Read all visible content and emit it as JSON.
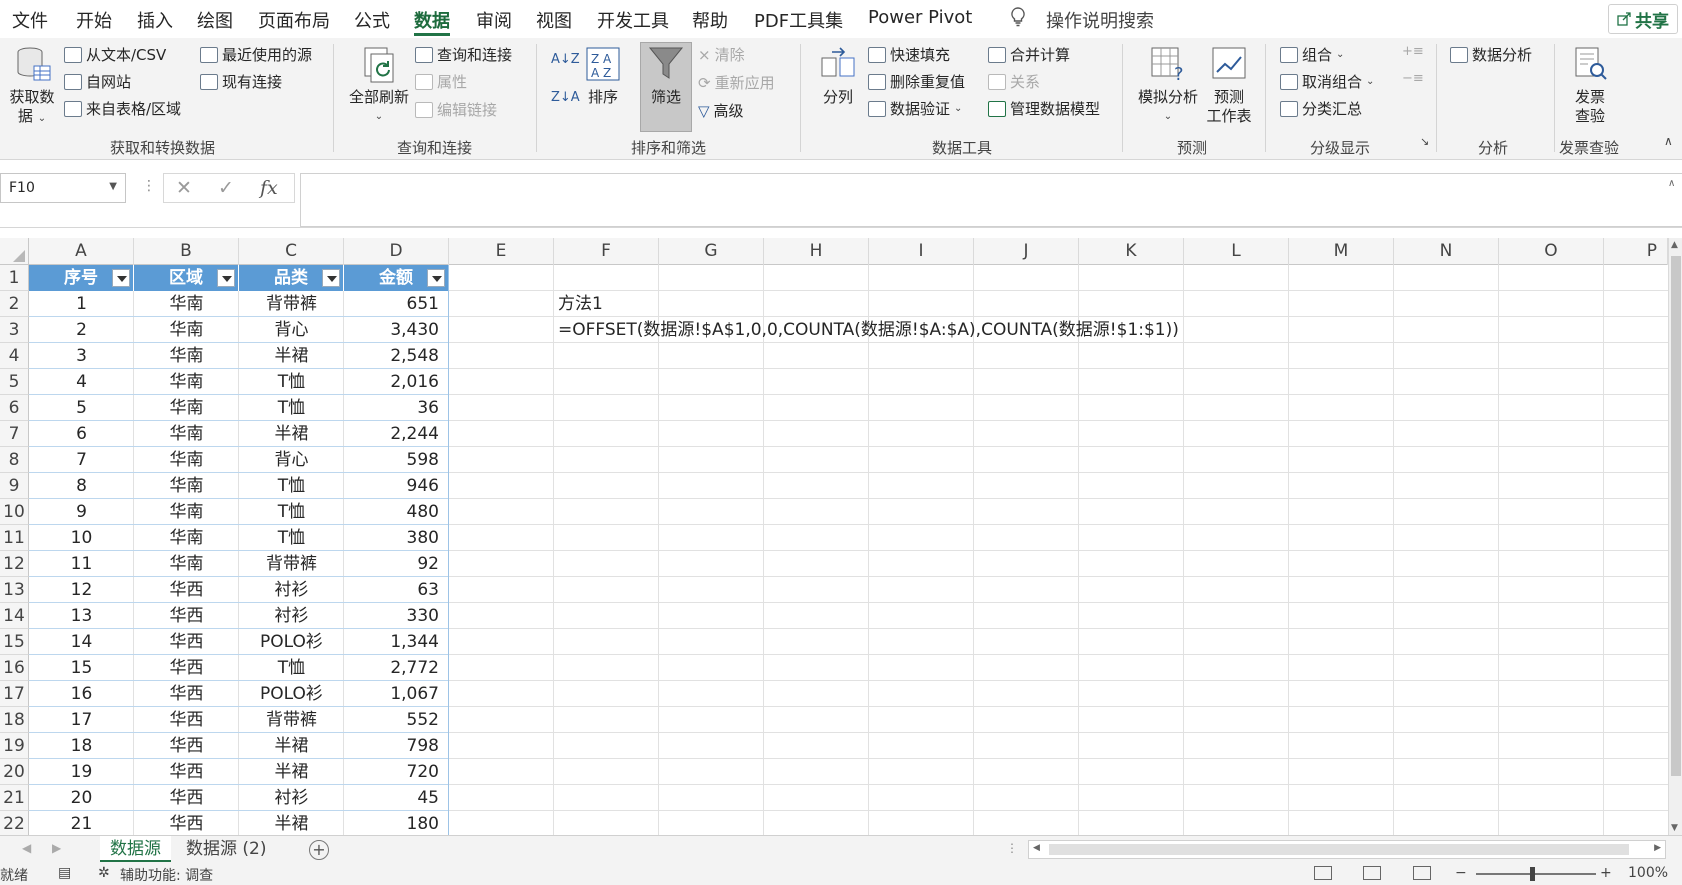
{
  "menu": {
    "items": [
      "文件",
      "开始",
      "插入",
      "绘图",
      "页面布局",
      "公式",
      "数据",
      "审阅",
      "视图",
      "开发工具",
      "帮助",
      "PDF工具集",
      "Power Pivot"
    ],
    "active": "数据",
    "search": "操作说明搜索",
    "share": "共享"
  },
  "ribbon": {
    "get_data": {
      "big_label_1": "获取数",
      "big_label_2": "据",
      "from_text": "从文本/CSV",
      "from_web": "自网站",
      "from_table": "来自表格/区域",
      "recent": "最近使用的源",
      "existing": "现有连接",
      "group": "获取和转换数据"
    },
    "queries": {
      "refresh_all": "全部刷新",
      "queries_conn": "查询和连接",
      "properties": "属性",
      "edit_links": "编辑链接",
      "group": "查询和连接"
    },
    "sort_filter": {
      "sort": "排序",
      "filter": "筛选",
      "clear": "清除",
      "reapply": "重新应用",
      "advanced": "高级",
      "group": "排序和筛选"
    },
    "data_tools": {
      "text_to_columns": "分列",
      "flash_fill": "快速填充",
      "remove_dup": "删除重复值",
      "validation": "数据验证",
      "consolidate": "合并计算",
      "relationships": "关系",
      "manage_model": "管理数据模型",
      "group": "数据工具"
    },
    "forecast": {
      "what_if": "模拟分析",
      "forecast_sheet_1": "预测",
      "forecast_sheet_2": "工作表",
      "group": "预测"
    },
    "outline": {
      "group_btn": "组合",
      "ungroup": "取消组合",
      "subtotal": "分类汇总",
      "group": "分级显示"
    },
    "analysis": {
      "data_analysis": "数据分析",
      "group": "分析"
    },
    "invoice": {
      "check_1": "发票",
      "check_2": "查验",
      "group": "发票查验"
    }
  },
  "formula_bar": {
    "name_box": "F10",
    "fx": "fx",
    "content": ""
  },
  "columns": [
    "A",
    "B",
    "C",
    "D",
    "E",
    "F",
    "G",
    "H",
    "I",
    "J",
    "K",
    "L",
    "M",
    "N",
    "O",
    "P"
  ],
  "table": {
    "headers": [
      "序号",
      "区域",
      "品类",
      "金额"
    ],
    "rows": [
      [
        "1",
        "华南",
        "背带裤",
        "651"
      ],
      [
        "2",
        "华南",
        "背心",
        "3,430"
      ],
      [
        "3",
        "华南",
        "半裙",
        "2,548"
      ],
      [
        "4",
        "华南",
        "T恤",
        "2,016"
      ],
      [
        "5",
        "华南",
        "T恤",
        "36"
      ],
      [
        "6",
        "华南",
        "半裙",
        "2,244"
      ],
      [
        "7",
        "华南",
        "背心",
        "598"
      ],
      [
        "8",
        "华南",
        "T恤",
        "946"
      ],
      [
        "9",
        "华南",
        "T恤",
        "480"
      ],
      [
        "10",
        "华南",
        "T恤",
        "380"
      ],
      [
        "11",
        "华南",
        "背带裤",
        "92"
      ],
      [
        "12",
        "华西",
        "衬衫",
        "63"
      ],
      [
        "13",
        "华西",
        "衬衫",
        "330"
      ],
      [
        "14",
        "华西",
        "POLO衫",
        "1,344"
      ],
      [
        "15",
        "华西",
        "T恤",
        "2,772"
      ],
      [
        "16",
        "华西",
        "POLO衫",
        "1,067"
      ],
      [
        "17",
        "华西",
        "背带裤",
        "552"
      ],
      [
        "18",
        "华西",
        "半裙",
        "798"
      ],
      [
        "19",
        "华西",
        "半裙",
        "720"
      ],
      [
        "20",
        "华西",
        "衬衫",
        "45"
      ],
      [
        "21",
        "华西",
        "半裙",
        "180"
      ]
    ]
  },
  "notes": {
    "method": "方法1",
    "formula": "=OFFSET(数据源!$A$1,0,0,COUNTA(数据源!$A:$A),COUNTA(数据源!$1:$1))"
  },
  "sheets": [
    "数据源",
    "数据源 (2)"
  ],
  "active_sheet": "数据源",
  "status": {
    "ready": "就绪",
    "accessibility": "辅助功能: 调查",
    "zoom": "100%"
  },
  "colors": {
    "accent": "#217346",
    "table_header": "#5b9bd5"
  }
}
